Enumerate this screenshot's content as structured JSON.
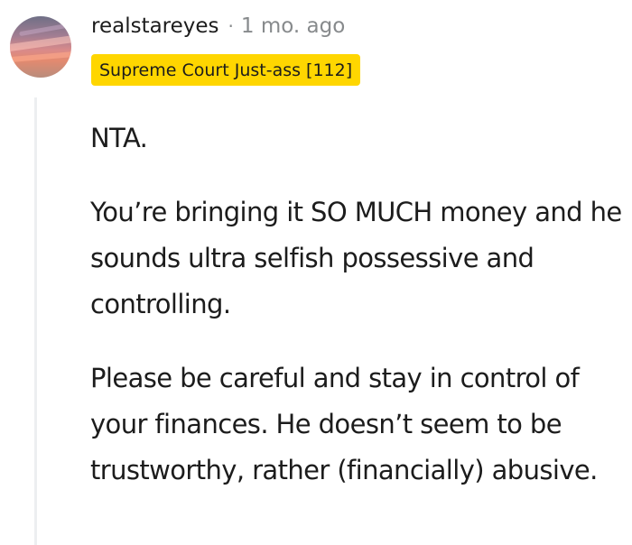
{
  "comment": {
    "avatar_icon": "user-avatar-sunset",
    "username": "realstareyes",
    "separator": "·",
    "timestamp": "1 mo. ago",
    "flair": {
      "text": "Supreme Court Just-ass [112]",
      "background": "#ffd600"
    },
    "paragraphs": [
      "NTA.",
      "You’re bringing it SO MUCH money and he sounds ultra selfish possessive and controlling.",
      "Please be careful and stay in control of your finances. He doesn’t seem to be trustworthy, rather (financially) abusive."
    ]
  }
}
